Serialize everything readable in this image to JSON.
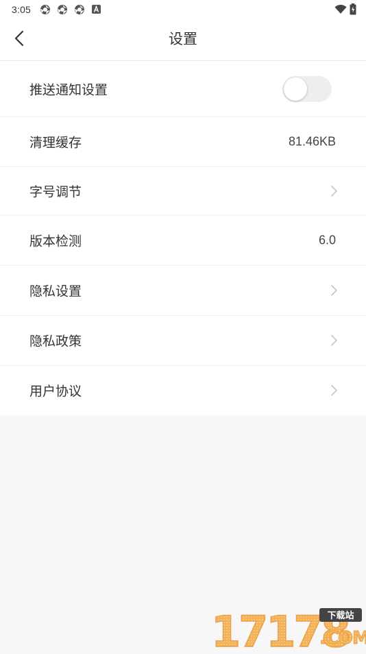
{
  "status_bar": {
    "time": "3:05",
    "notification_icons": [
      "chrome-like-icon",
      "chrome-like-icon",
      "chrome-like-icon",
      "a-letter-icon"
    ],
    "right_icons": [
      "wifi-icon",
      "battery-icon"
    ]
  },
  "header": {
    "title": "设置",
    "back_icon": "back-arrow-icon"
  },
  "settings": {
    "push": {
      "label": "推送通知设置",
      "toggle_on": false
    },
    "cache": {
      "label": "清理缓存",
      "value": "81.46KB"
    },
    "font_size": {
      "label": "字号调节"
    },
    "version": {
      "label": "版本检测",
      "value": "6.0"
    },
    "privacy_settings": {
      "label": "隐私设置"
    },
    "privacy_policy": {
      "label": "隐私政策"
    },
    "user_agreement": {
      "label": "用户协议"
    }
  },
  "watermark": {
    "number": "17178",
    "tag": "下载站",
    "domain": ".COM"
  },
  "colors": {
    "background": "#f7f7f7",
    "surface": "#ffffff",
    "text": "#333333",
    "chevron": "#c8c8c8",
    "toggle_track": "#eeeeee",
    "watermark_orange": "#f3b25a"
  }
}
